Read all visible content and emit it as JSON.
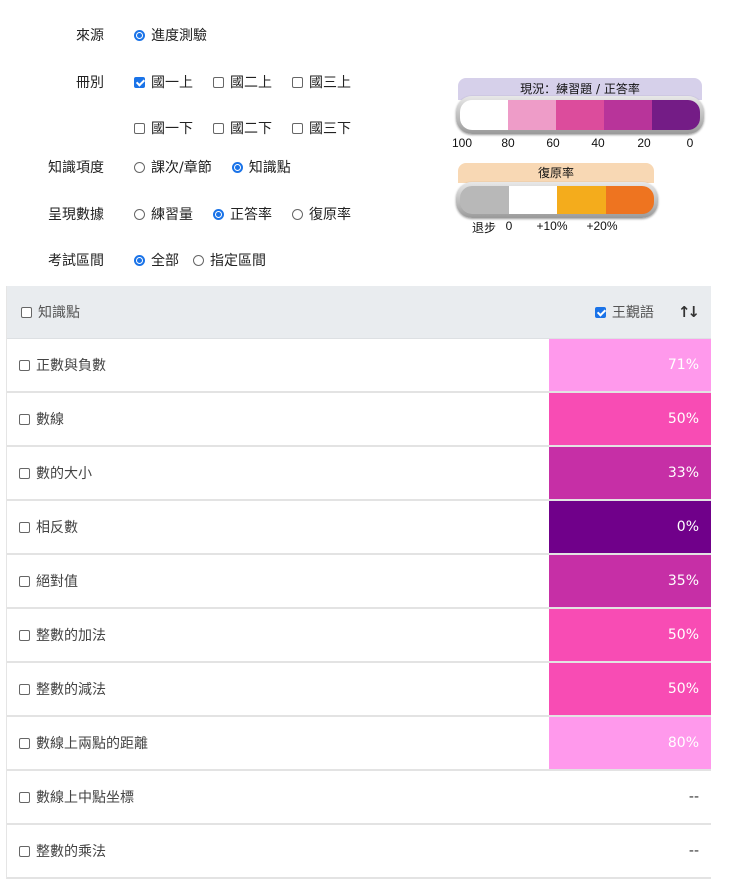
{
  "filters": {
    "source": {
      "label": "來源",
      "options": [
        {
          "label": "進度測驗",
          "selected": true
        }
      ]
    },
    "volume": {
      "label": "冊別",
      "options": [
        {
          "label": "國一上",
          "checked": true
        },
        {
          "label": "國二上",
          "checked": false
        },
        {
          "label": "國三上",
          "checked": false
        },
        {
          "label": "國一下",
          "checked": false
        },
        {
          "label": "國二下",
          "checked": false
        },
        {
          "label": "國三下",
          "checked": false
        }
      ]
    },
    "knowledge_level": {
      "label": "知識項度",
      "options": [
        {
          "label": "課次/章節",
          "selected": false
        },
        {
          "label": "知識點",
          "selected": true
        }
      ]
    },
    "display_data": {
      "label": "呈現數據",
      "options": [
        {
          "label": "練習量",
          "selected": false
        },
        {
          "label": "正答率",
          "selected": true
        },
        {
          "label": "復原率",
          "selected": false
        }
      ]
    },
    "exam_range": {
      "label": "考試區間",
      "options": [
        {
          "label": "全部",
          "selected": true
        },
        {
          "label": "指定區間",
          "selected": false
        }
      ]
    }
  },
  "legend_accuracy": {
    "title": "現況：練習題 / 正答率",
    "colors": [
      "#ffffff",
      "#ee9cc8",
      "#dc4c9c",
      "#b8349a",
      "#741c86"
    ],
    "ticks": [
      "100",
      "80",
      "60",
      "40",
      "20",
      "0"
    ]
  },
  "legend_recovery": {
    "title": "復原率",
    "colors": [
      "#b8b8b8",
      "#ffffff",
      "#f4ac1c",
      "#ee7420"
    ],
    "ticks": [
      "退步",
      "0",
      "+10%",
      "+20%"
    ]
  },
  "table": {
    "header": {
      "select_all_label": "知識點",
      "student_label": "王覲語",
      "student_checked": true,
      "sort_icon": "sort-arrows-icon"
    },
    "rows": [
      {
        "name": "正數與負數",
        "value": "71%",
        "color": "#ff99ec"
      },
      {
        "name": "數線",
        "value": "50%",
        "color": "#f84cb4"
      },
      {
        "name": "數的大小",
        "value": "33%",
        "color": "#c62fa6"
      },
      {
        "name": "相反數",
        "value": "0%",
        "color": "#70008a"
      },
      {
        "name": "絕對值",
        "value": "35%",
        "color": "#c62fa6"
      },
      {
        "name": "整數的加法",
        "value": "50%",
        "color": "#f84cb4"
      },
      {
        "name": "整數的減法",
        "value": "50%",
        "color": "#f84cb4"
      },
      {
        "name": "數線上兩點的距離",
        "value": "80%",
        "color": "#ff99ec"
      },
      {
        "name": "數線上中點坐標",
        "value": "--",
        "color": ""
      },
      {
        "name": "整數的乘法",
        "value": "--",
        "color": ""
      }
    ]
  }
}
